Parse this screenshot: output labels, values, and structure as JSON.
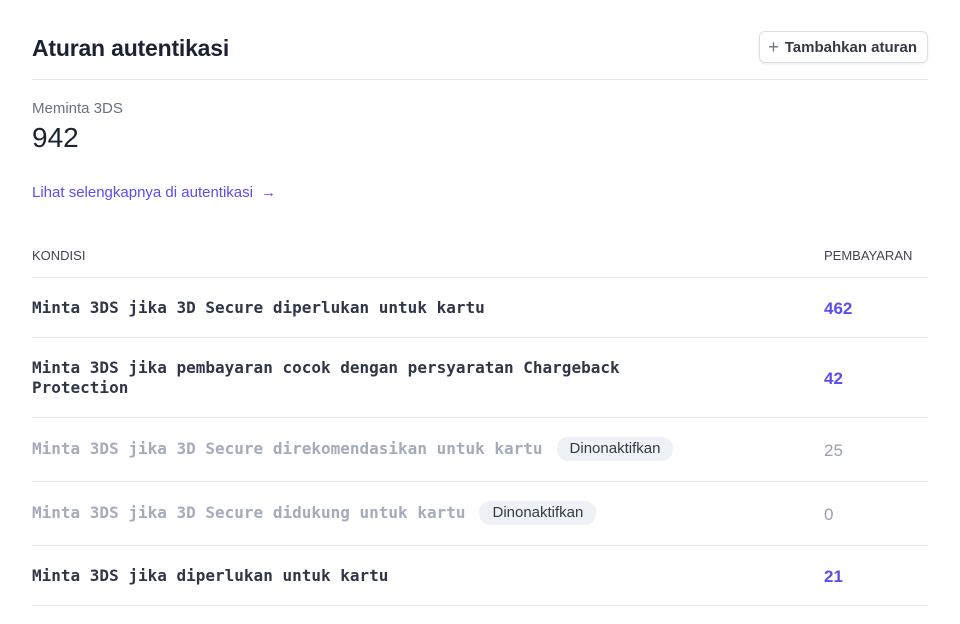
{
  "header": {
    "title": "Aturan autentikasi",
    "add_button_label": "Tambahkan aturan"
  },
  "metric": {
    "label": "Meminta 3DS",
    "value": "942"
  },
  "more_link": {
    "label": "Lihat selengkapnya di autentikasi"
  },
  "table": {
    "headers": {
      "condition": "KONDISI",
      "payments": "PEMBAYARAN"
    },
    "rows": [
      {
        "condition": "Minta 3DS jika 3D Secure diperlukan untuk kartu",
        "badge": "",
        "payments": "462",
        "enabled": true
      },
      {
        "condition": "Minta 3DS jika pembayaran cocok dengan persyaratan Chargeback Protection",
        "badge": "",
        "payments": "42",
        "enabled": true
      },
      {
        "condition": "Minta 3DS jika 3D Secure direkomendasikan untuk kartu",
        "badge": "Dinonaktifkan",
        "payments": "25",
        "enabled": false
      },
      {
        "condition": "Minta 3DS jika 3D Secure didukung untuk kartu",
        "badge": "Dinonaktifkan",
        "payments": "0",
        "enabled": false
      },
      {
        "condition": "Minta 3DS jika diperlukan untuk kartu",
        "badge": "",
        "payments": "21",
        "enabled": true
      }
    ]
  },
  "colors": {
    "accent": "#5b4df0",
    "disabled_text": "#a3acba",
    "badge_bg": "#eef1f5"
  }
}
